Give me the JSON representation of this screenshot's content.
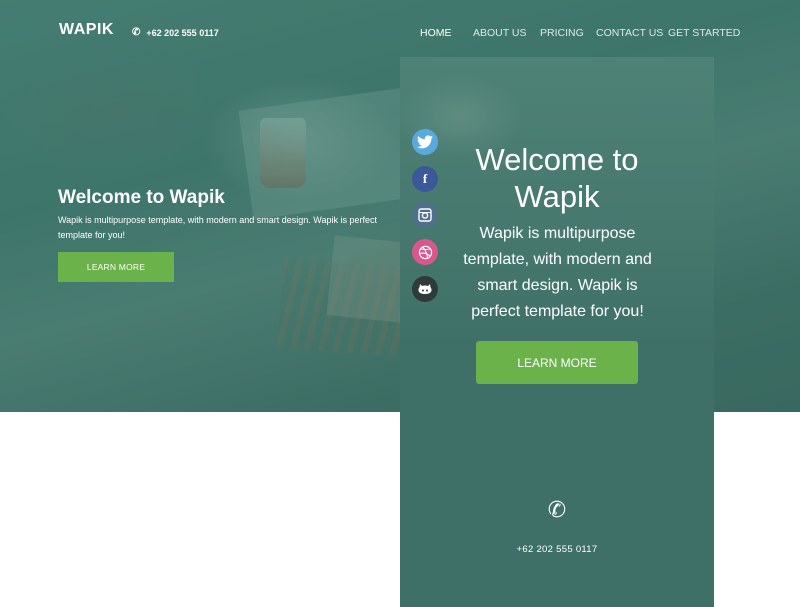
{
  "brand": {
    "logo": "WAPIK"
  },
  "header": {
    "phone_icon": "✆",
    "phone": "+62 202 555 0117"
  },
  "nav": {
    "items": [
      {
        "label": "HOME",
        "active": true
      },
      {
        "label": "ABOUT US",
        "active": false
      },
      {
        "label": "PRICING",
        "active": false
      },
      {
        "label": "CONTACT US",
        "active": false
      },
      {
        "label": "GET STARTED",
        "active": false
      }
    ]
  },
  "hero": {
    "title": "Welcome to Wapik",
    "text": "Wapik is multipurpose template, with modern and smart design. Wapik is perfect template for you!",
    "button": "LEARN MORE"
  },
  "mobile": {
    "title_line1": "Welcome to",
    "title_line2": "Wapik",
    "text": "Wapik is multipurpose template, with modern and smart design. Wapik is perfect template for you!",
    "button": "LEARN MORE",
    "phone_icon": "✆",
    "phone": "+62 202 555 0117",
    "social": [
      {
        "name": "twitter-icon",
        "glyph": "🐦"
      },
      {
        "name": "facebook-icon",
        "glyph": "f"
      },
      {
        "name": "instagram-icon",
        "glyph": "◘"
      },
      {
        "name": "dribbble-icon",
        "glyph": "◍"
      },
      {
        "name": "github-icon",
        "glyph": "◉"
      }
    ]
  },
  "colors": {
    "accent_green": "#6bb24a",
    "teal": "#3f7068",
    "text": "#ffffff"
  }
}
